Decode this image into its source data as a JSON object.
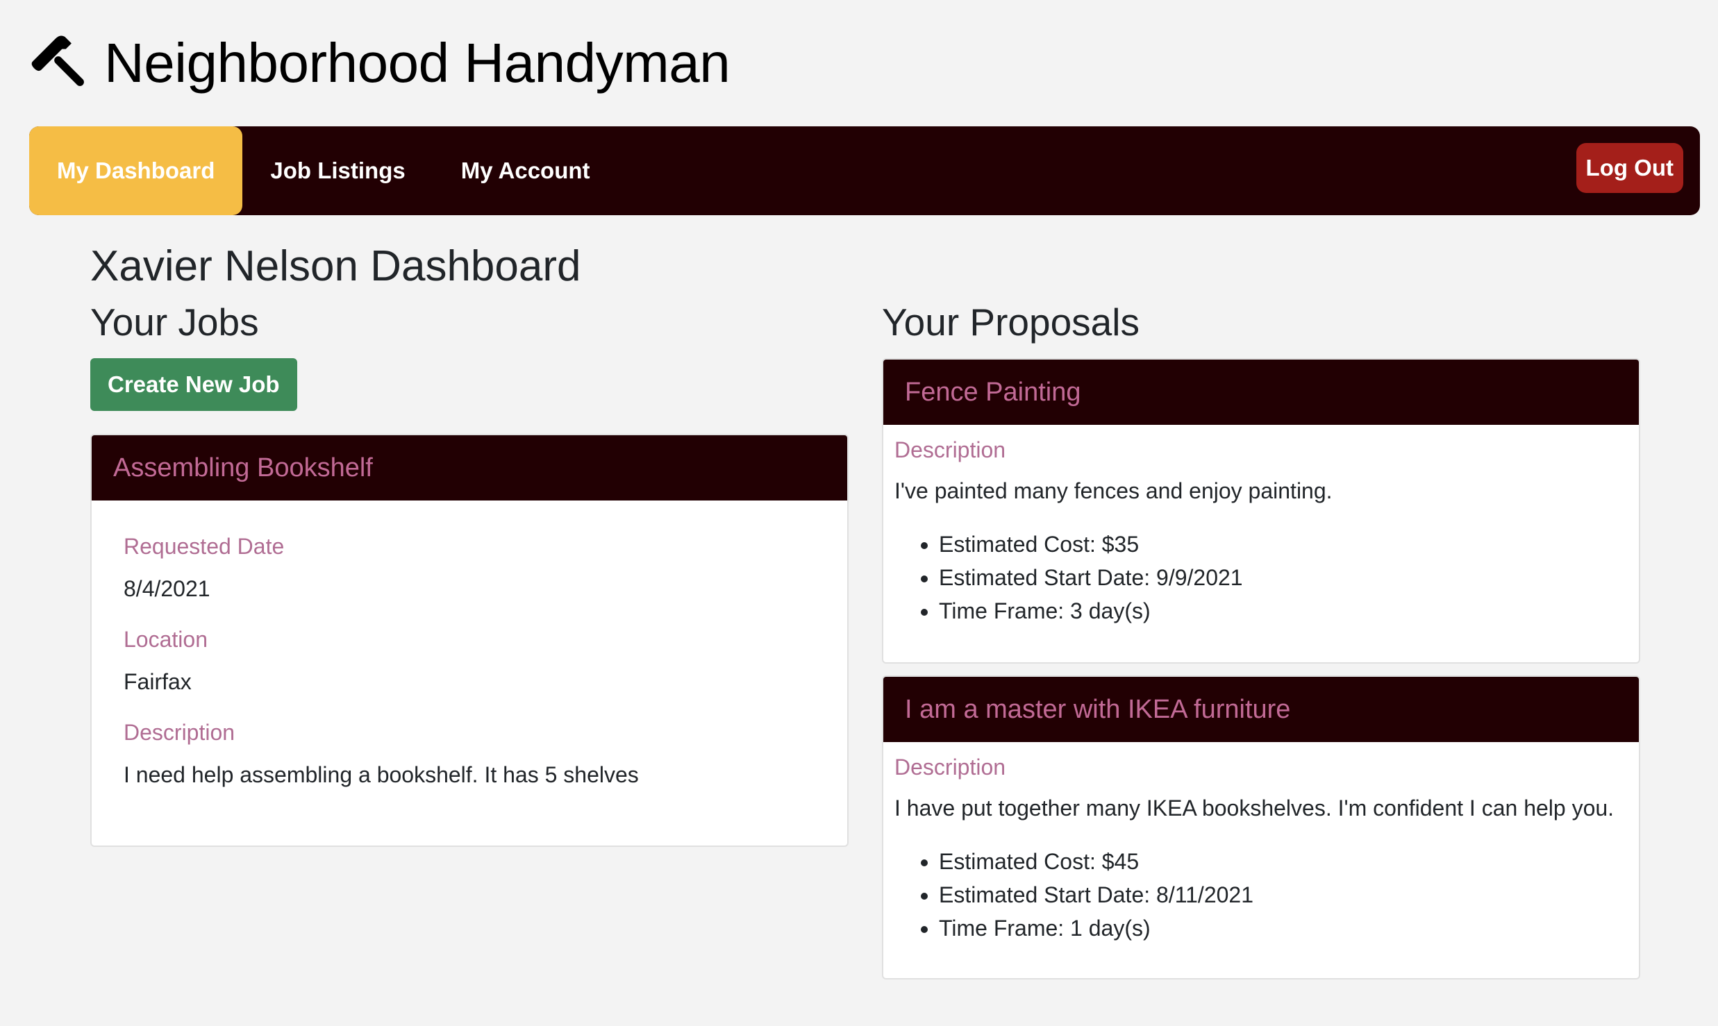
{
  "header": {
    "title": "Neighborhood Handyman",
    "icon": "hammer-icon"
  },
  "nav": {
    "items": [
      {
        "label": "My Dashboard",
        "active": true
      },
      {
        "label": "Job Listings",
        "active": false
      },
      {
        "label": "My Account",
        "active": false
      }
    ],
    "logout_label": "Log Out"
  },
  "dashboard": {
    "title": "Xavier Nelson Dashboard"
  },
  "jobs": {
    "section_title": "Your Jobs",
    "create_label": "Create New Job",
    "items": [
      {
        "title": "Assembling Bookshelf",
        "requested_date_label": "Requested Date",
        "requested_date": "8/4/2021",
        "location_label": "Location",
        "location": "Fairfax",
        "description_label": "Description",
        "description": "I need help assembling a bookshelf. It has 5 shelves"
      }
    ]
  },
  "proposals": {
    "section_title": "Your Proposals",
    "items": [
      {
        "title": "Fence Painting",
        "description_label": "Description",
        "description": "I've painted many fences and enjoy painting.",
        "details": [
          "Estimated Cost: $35",
          "Estimated Start Date: 9/9/2021",
          "Time Frame: 3 day(s)"
        ]
      },
      {
        "title": "I am a master with IKEA furniture",
        "description_label": "Description",
        "description": "I have put together many IKEA bookshelves. I'm confident I can help you.",
        "details": [
          "Estimated Cost: $45",
          "Estimated Start Date: 8/11/2021",
          "Time Frame: 1 day(s)"
        ]
      }
    ]
  },
  "colors": {
    "navbar_bg": "#220003",
    "active_tab": "#f5bd45",
    "logout": "#a41f1a",
    "create_button": "#3e8b59",
    "card_title": "#c26a96",
    "field_label": "#b06d93"
  }
}
